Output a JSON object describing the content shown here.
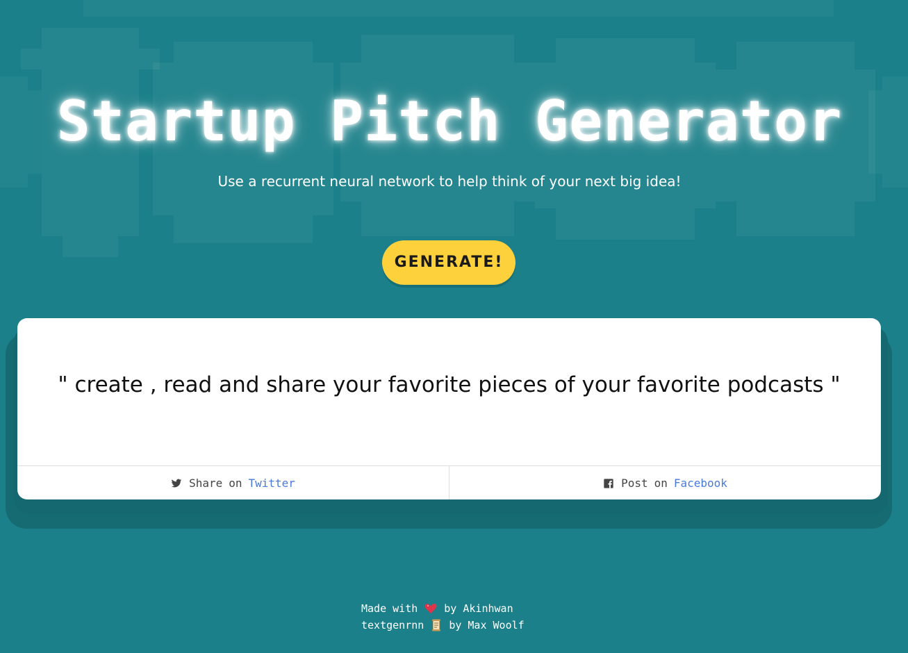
{
  "header": {
    "title": "Startup Pitch Generator",
    "subtitle": "Use a recurrent neural network to help think of your next big idea!"
  },
  "generate_button": {
    "label": "GENERATE!"
  },
  "pitch_card": {
    "pitch_text": "\" create , read and share your favorite pieces of your favorite podcasts \"",
    "twitter": {
      "prefix": "Share",
      "on": "on",
      "link": "Twitter",
      "icon": "twitter-icon"
    },
    "facebook": {
      "prefix": "Post",
      "on": "on",
      "link": "Facebook",
      "icon": "facebook-icon"
    }
  },
  "footer": {
    "line1_prefix": "Made with",
    "line1_suffix": "by Akinhwan",
    "line1_icon": "heart-icon",
    "line2_prefix": "textgenrnn",
    "line2_suffix": "by Max Woolf",
    "line2_icon": "scroll-icon"
  },
  "colors": {
    "background": "#1b8089",
    "button": "#fdd13c",
    "link": "#4a7ad9"
  }
}
